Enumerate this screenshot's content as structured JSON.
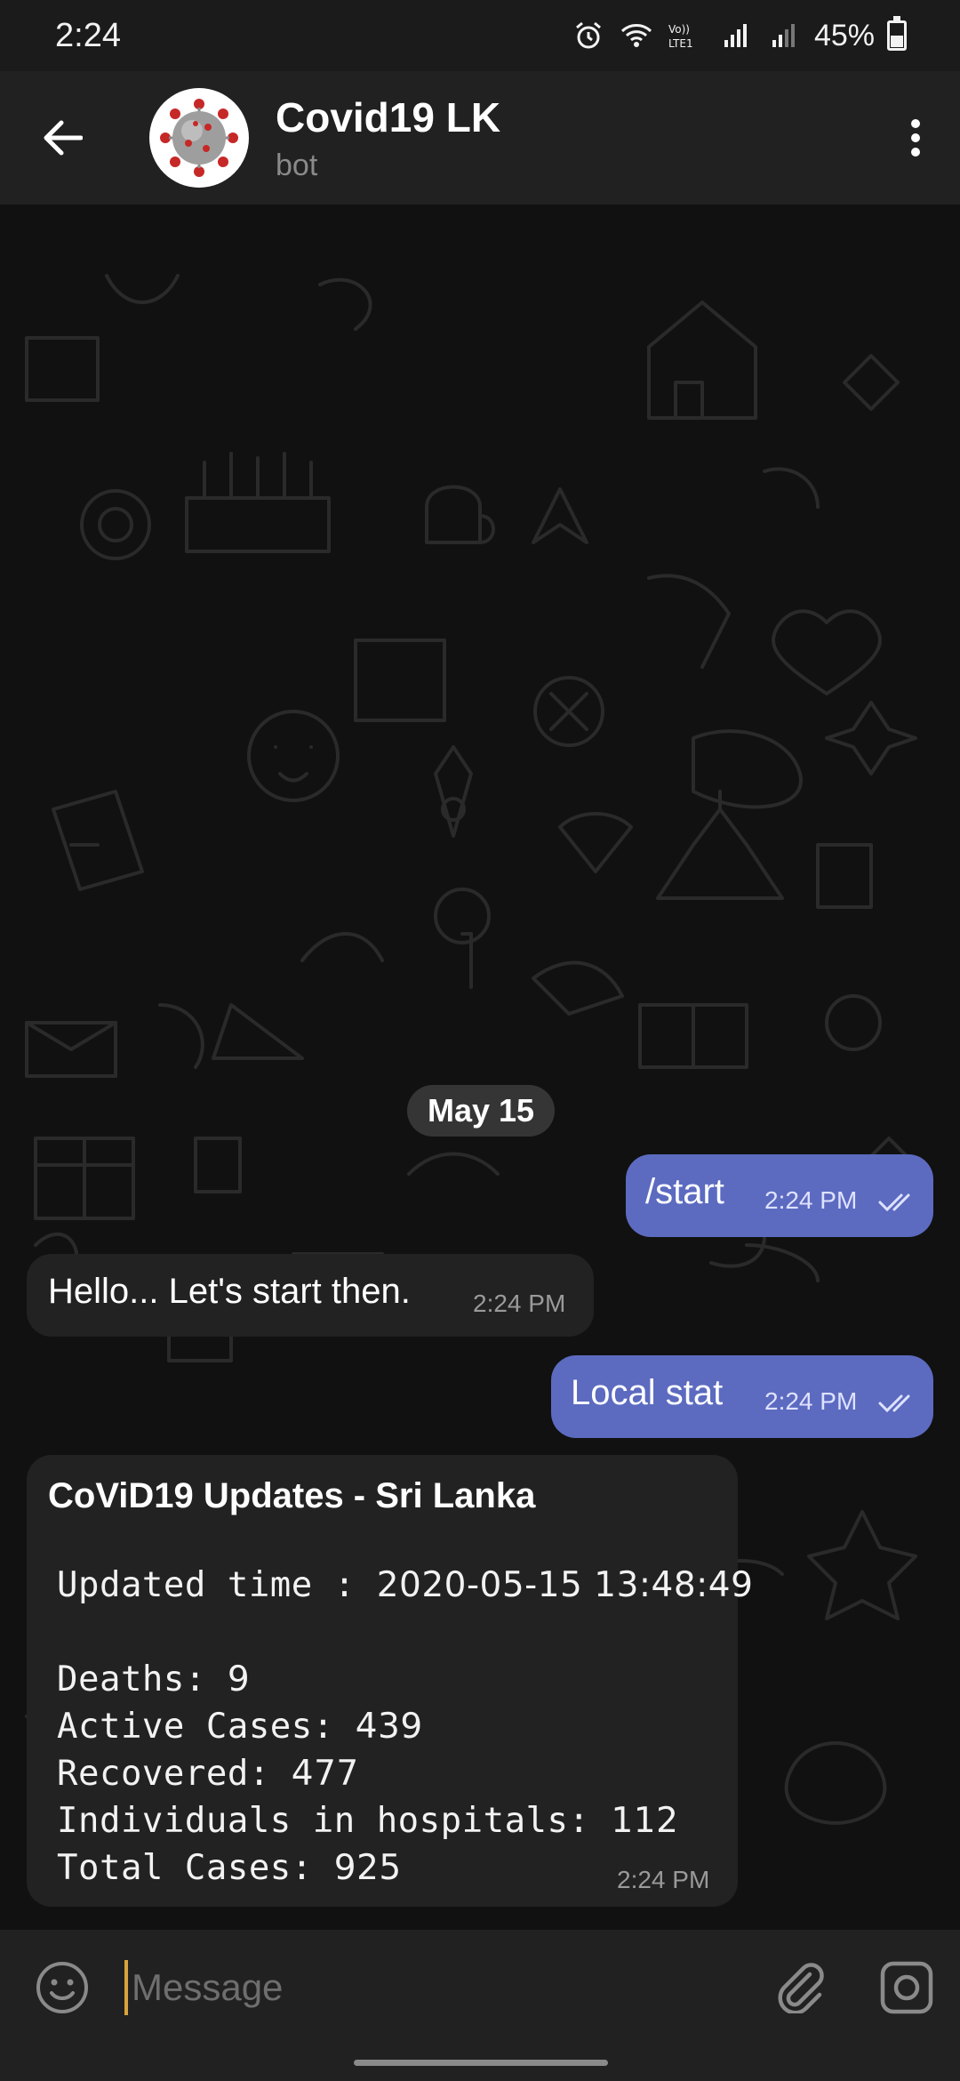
{
  "status_bar": {
    "time": "2:24",
    "battery": "45%",
    "battery_level": 0.45,
    "network_label": "Vo)) LTE1",
    "icons": [
      "alarm-icon",
      "wifi-icon",
      "volte-icon",
      "signal-icon",
      "signal-icon-2",
      "battery-icon"
    ]
  },
  "header": {
    "title": "Covid19 LK",
    "subtitle": "bot",
    "back_icon": "back-arrow-icon",
    "menu_icon": "more-vertical-icon",
    "avatar": "coronavirus-avatar"
  },
  "date_chip": "May 15",
  "messages": [
    {
      "direction": "outgoing",
      "text": "/start",
      "time": "2:24 PM",
      "status": "read"
    },
    {
      "direction": "incoming",
      "text": "Hello... Let's start then.",
      "time": "2:24 PM"
    },
    {
      "direction": "outgoing",
      "text": "Local stat",
      "time": "2:24 PM",
      "status": "read"
    },
    {
      "direction": "incoming",
      "title": "CoViD19 Updates - Sri Lanka",
      "updated_label": "Updated time :",
      "updated_value": "2020-05-15 13:48:49",
      "stats": [
        {
          "label": "Deaths:",
          "value": "9"
        },
        {
          "label": "Active Cases:",
          "value": "439"
        },
        {
          "label": "Recovered:",
          "value": "477"
        },
        {
          "label": "Individuals in hospitals:",
          "value": "112"
        },
        {
          "label": "Total Cases:",
          "value": "925"
        }
      ],
      "time": "2:24 PM"
    }
  ],
  "input": {
    "placeholder": "Message",
    "emoji_icon": "emoji-icon",
    "attach_icon": "paperclip-icon",
    "camera_icon": "camera-icon"
  },
  "colors": {
    "outgoing_bubble": "#5c6bc0",
    "incoming_bubble": "#222222",
    "header": "#212121",
    "background": "#111111",
    "caret": "#d8a33b"
  }
}
